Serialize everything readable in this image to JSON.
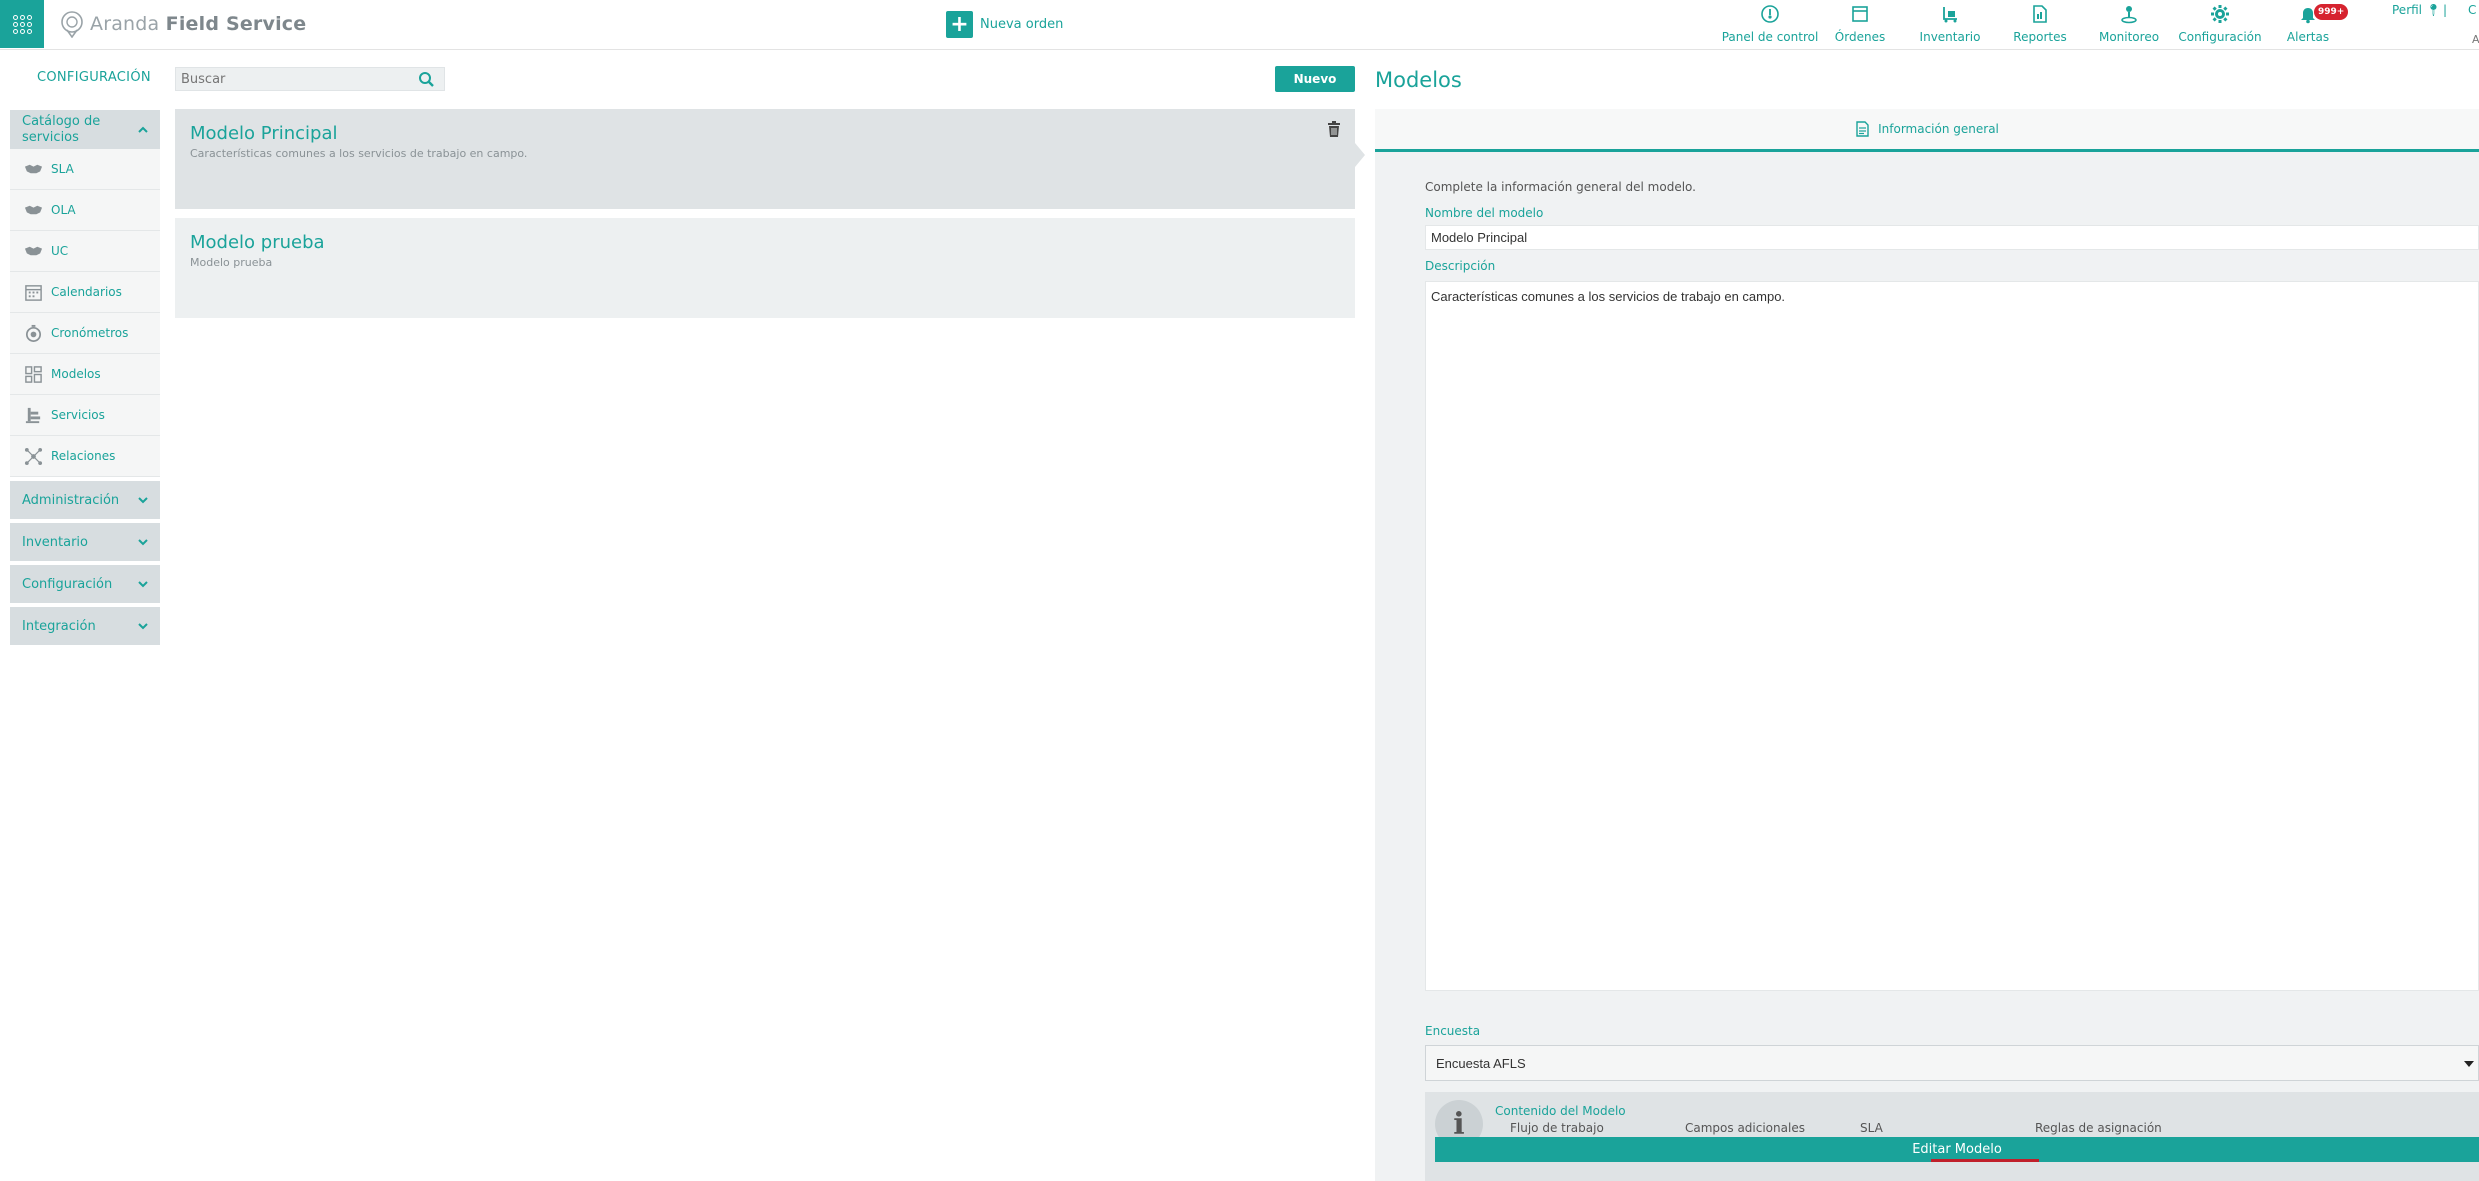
{
  "header": {
    "brand_light": "Aranda",
    "brand_bold": "Field Service",
    "new_order_label": "Nueva orden",
    "nav": [
      {
        "label": "Panel de control",
        "icon": "dashboard-icon"
      },
      {
        "label": "Órdenes",
        "icon": "orders-icon"
      },
      {
        "label": "Inventario",
        "icon": "inventory-icon"
      },
      {
        "label": "Reportes",
        "icon": "reports-icon"
      },
      {
        "label": "Monitoreo",
        "icon": "monitor-icon"
      },
      {
        "label": "Configuración",
        "icon": "gear-icon"
      },
      {
        "label": "Alertas",
        "icon": "bell-icon"
      }
    ],
    "alerts_badge": "999+",
    "profile_label": "Perfil",
    "profile_sep": "|",
    "profile_c": "C",
    "profile_a": "A"
  },
  "sidebar": {
    "title": "CONFIGURACIÓN",
    "open_group": "Catálogo de servicios",
    "items": [
      {
        "label": "SLA",
        "icon": "handshake-icon"
      },
      {
        "label": "OLA",
        "icon": "handshake-icon"
      },
      {
        "label": "UC",
        "icon": "handshake-icon"
      },
      {
        "label": "Calendarios",
        "icon": "calendar-icon"
      },
      {
        "label": "Cronómetros",
        "icon": "stopwatch-icon"
      },
      {
        "label": "Modelos",
        "icon": "models-icon"
      },
      {
        "label": "Servicios",
        "icon": "services-icon"
      },
      {
        "label": "Relaciones",
        "icon": "relations-icon"
      }
    ],
    "groups": [
      "Administración",
      "Inventario",
      "Configuración",
      "Integración"
    ]
  },
  "list": {
    "search_placeholder": "Buscar",
    "new_button": "Nuevo",
    "items": [
      {
        "title": "Modelo Principal",
        "description": "Características comunes a los servicios de trabajo en campo."
      },
      {
        "title": "Modelo prueba",
        "description": "Modelo prueba"
      }
    ]
  },
  "detail": {
    "title": "Modelos",
    "tab_label": "Información general",
    "intro": "Complete la información general del modelo.",
    "name_label": "Nombre del modelo",
    "name_value": "Modelo Principal",
    "description_label": "Descripción",
    "description_value": "Características comunes a los servicios de trabajo en campo.",
    "survey_label": "Encuesta",
    "survey_value": "Encuesta AFLS",
    "content_title": "Contenido del Modelo",
    "content_items": [
      "Flujo de trabajo",
      "Campos adicionales",
      "SLA",
      "Reglas de asignación"
    ],
    "edit_button": "Editar Modelo"
  },
  "colors": {
    "accent": "#1aa39a",
    "badge": "#d6232f"
  }
}
